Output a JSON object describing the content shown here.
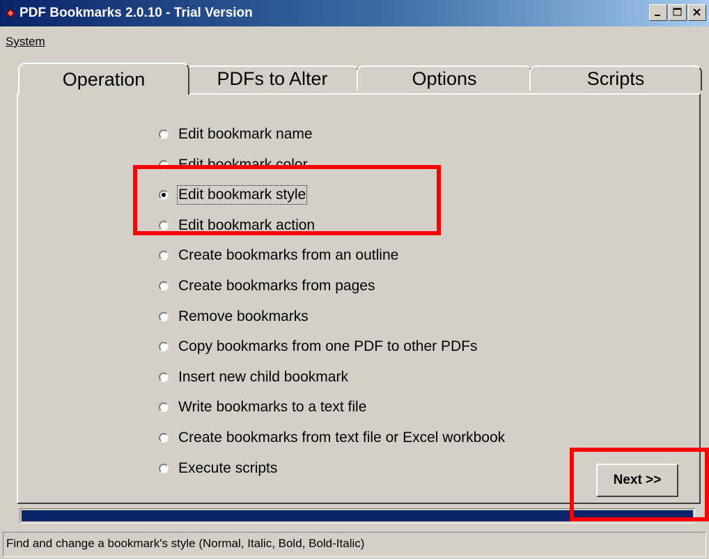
{
  "window": {
    "title": "PDF Bookmarks 2.0.10 - Trial Version",
    "icon": "app-book-icon"
  },
  "menu": {
    "system_label": "System"
  },
  "tabs": [
    {
      "label": "Operation",
      "active": true
    },
    {
      "label": "PDFs to Alter",
      "active": false
    },
    {
      "label": "Options",
      "active": false
    },
    {
      "label": "Scripts",
      "active": false
    }
  ],
  "operations": {
    "selected_index": 2,
    "items": [
      {
        "label": "Edit bookmark name"
      },
      {
        "label": "Edit bookmark color"
      },
      {
        "label": "Edit bookmark style"
      },
      {
        "label": "Edit bookmark action"
      },
      {
        "label": "Create bookmarks from an outline"
      },
      {
        "label": "Create bookmarks from pages"
      },
      {
        "label": "Remove bookmarks"
      },
      {
        "label": "Copy bookmarks from one PDF to other PDFs"
      },
      {
        "label": "Insert new child bookmark"
      },
      {
        "label": "Write bookmarks to a text file"
      },
      {
        "label": "Create bookmarks from text file or Excel workbook"
      },
      {
        "label": "Execute scripts"
      }
    ]
  },
  "next_button": {
    "label": "Next >>"
  },
  "progress": {
    "fraction": 1.0,
    "color": "#0a246a"
  },
  "status_bar": {
    "text": "Find and change a bookmark's style (Normal, Italic, Bold, Bold-Italic)"
  },
  "colors": {
    "annotation": "#ff0000",
    "title_bar": "#0a246a",
    "face": "#d4d0c8"
  }
}
